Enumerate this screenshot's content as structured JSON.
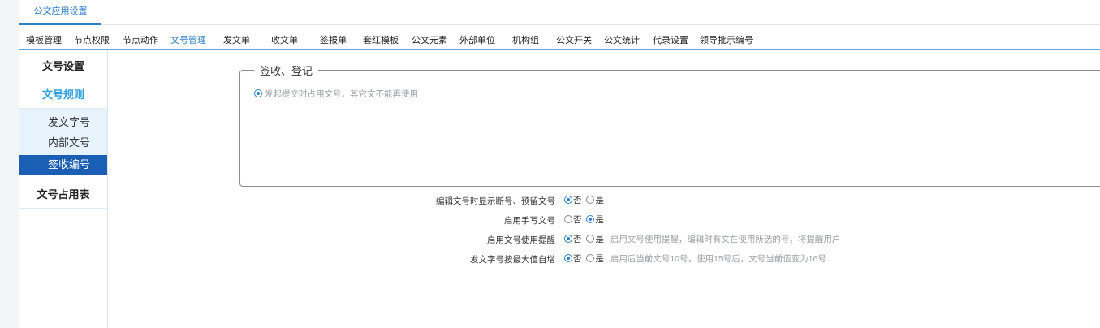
{
  "top_tab": {
    "label": "公文应用设置"
  },
  "menu": [
    {
      "label": "模板管理",
      "active": false
    },
    {
      "label": "节点权限",
      "active": false
    },
    {
      "label": "节点动作",
      "active": false
    },
    {
      "label": "文号管理",
      "active": true
    },
    {
      "label": "发文单",
      "active": false
    },
    {
      "label": "收文单",
      "active": false
    },
    {
      "label": "签报单",
      "active": false
    },
    {
      "label": "套红模板",
      "active": false
    },
    {
      "label": "公文元素",
      "active": false
    },
    {
      "label": "外部单位",
      "active": false
    },
    {
      "label": "机构组",
      "active": false
    },
    {
      "label": "公文开关",
      "active": false
    },
    {
      "label": "公文统计",
      "active": false
    },
    {
      "label": "代录设置",
      "active": false
    },
    {
      "label": "领导批示编号",
      "active": false
    }
  ],
  "sidebar": {
    "settings": "文号设置",
    "rules": "文号规则",
    "subitems": [
      "发文字号",
      "内部文号",
      "签收编号"
    ],
    "selected": "签收编号",
    "usage_table": "文号占用表"
  },
  "fieldset": {
    "legend": "签收、登记",
    "option": "发起提交时占用文号，其它文不能再使用"
  },
  "options": {
    "no": "否",
    "yes": "是",
    "rows": [
      {
        "label": "编辑文号时显示断号、预留文号",
        "value": "no",
        "hint": ""
      },
      {
        "label": "启用手写文号",
        "value": "yes",
        "hint": ""
      },
      {
        "label": "启用文号使用提醒",
        "value": "no",
        "hint": "启用文号使用提醒，编辑时有文在使用所选的号，将提醒用户"
      },
      {
        "label": "发文字号按最大值自增",
        "value": "no",
        "hint": "启用后当前文号10号，使用15号后，文号当前值变为16号"
      }
    ]
  }
}
